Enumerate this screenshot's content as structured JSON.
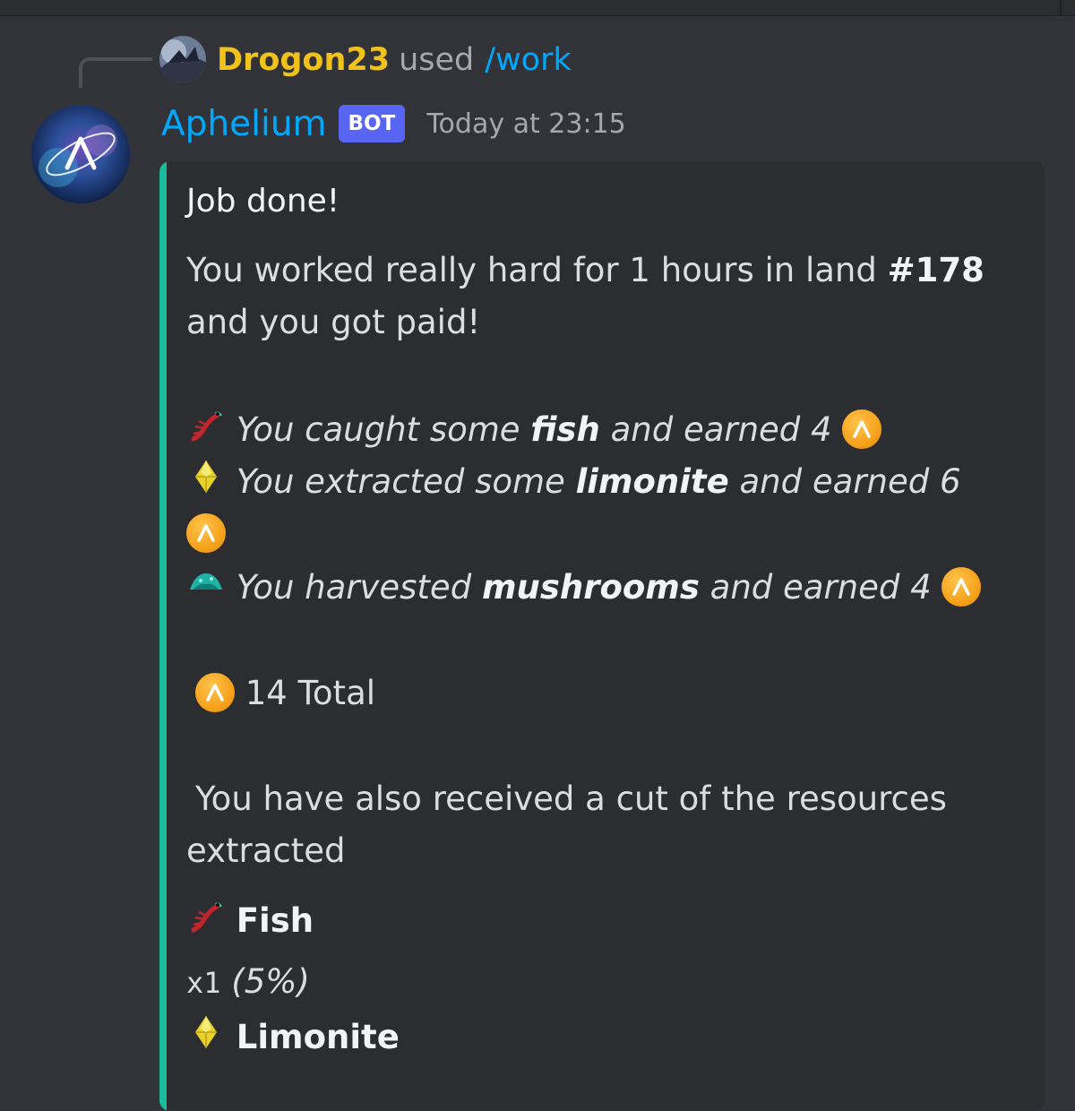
{
  "reply": {
    "username": "Drogon23",
    "action": "used",
    "command": "/work"
  },
  "message": {
    "author": "Aphelium",
    "badge": "BOT",
    "timestamp": "Today at 23:15"
  },
  "embed": {
    "accent_color": "#1abc9c",
    "title": "Job done!",
    "intro_line1": "You worked really hard for 1 hours in land",
    "intro_land": "#178",
    "intro_line2": "and you got paid!",
    "earnings": [
      {
        "icon": "shrimp-fish-icon",
        "pre": "You caught some",
        "item": "fish",
        "post": "and earned 4"
      },
      {
        "icon": "limonite-gem-icon",
        "pre": "You extracted some",
        "item": "limonite",
        "post": "and earned 6"
      },
      {
        "icon": "mushroom-icon",
        "pre": "You harvested",
        "item": "mushrooms",
        "post": "and earned 4"
      }
    ],
    "total": "14 Total",
    "cut_line1": "You have also received a cut of the resources",
    "cut_line2": "extracted",
    "resources": [
      {
        "icon": "shrimp-fish-icon",
        "name": "Fish",
        "qty": "x1",
        "pct": "(5%)"
      },
      {
        "icon": "limonite-gem-icon",
        "name": "Limonite"
      }
    ]
  },
  "colors": {
    "background": "#313338",
    "embed_background": "#2b2d31",
    "username": "#f0c21a",
    "bot_name": "#00a8fc",
    "badge": "#5865f2",
    "coin": "#f7a21b"
  }
}
